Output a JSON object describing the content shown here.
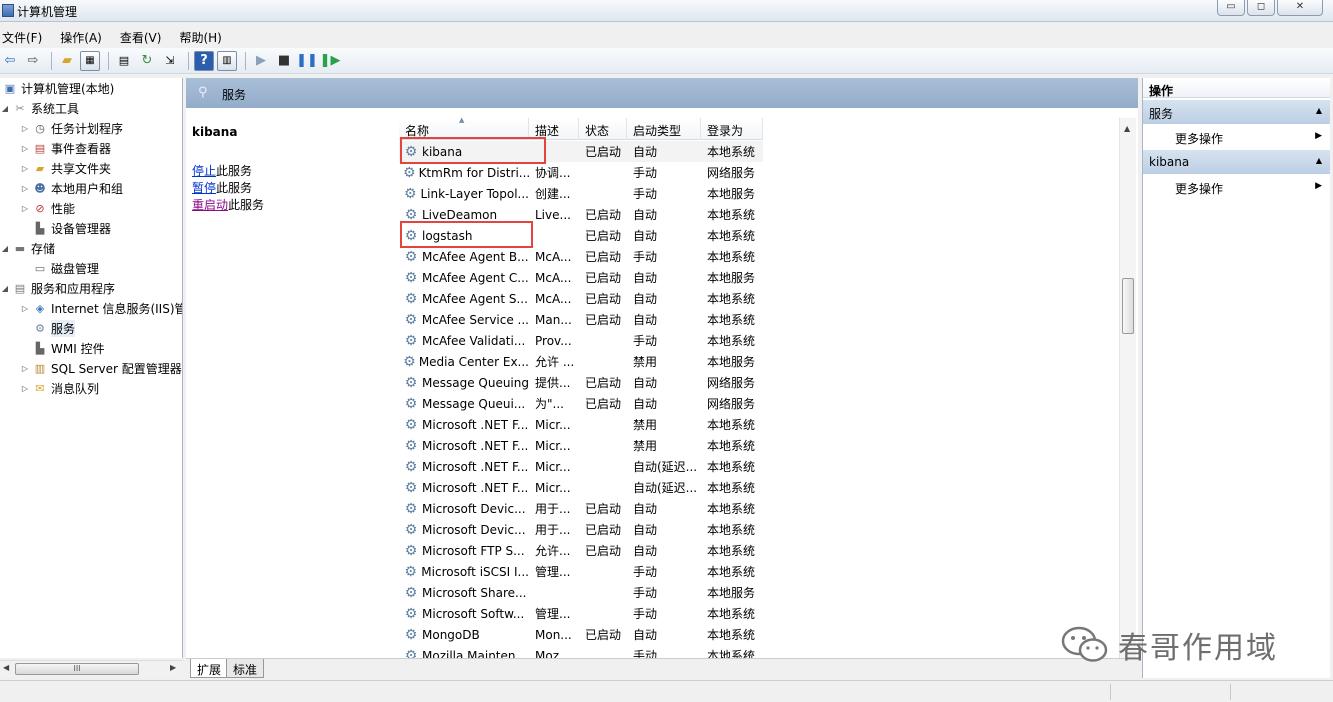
{
  "window": {
    "title": "计算机管理",
    "controls": [
      "▭",
      "◻",
      "✕"
    ]
  },
  "menu": [
    "文件(F)",
    "操作(A)",
    "查看(V)",
    "帮助(H)"
  ],
  "tree": {
    "root": "计算机管理(本地)",
    "items": [
      {
        "label": "系统工具",
        "icon": "tools-icon"
      },
      {
        "label": "任务计划程序",
        "icon": "clock-icon"
      },
      {
        "label": "事件查看器",
        "icon": "event-viewer-icon"
      },
      {
        "label": "共享文件夹",
        "icon": "shared-folder-icon"
      },
      {
        "label": "本地用户和组",
        "icon": "users-icon"
      },
      {
        "label": "性能",
        "icon": "performance-icon"
      },
      {
        "label": "设备管理器",
        "icon": "device-manager-icon"
      },
      {
        "label": "存储",
        "icon": "storage-icon"
      },
      {
        "label": "磁盘管理",
        "icon": "disk-icon"
      },
      {
        "label": "服务和应用程序",
        "icon": "services-apps-icon"
      },
      {
        "label": "Internet 信息服务(IIS)管",
        "icon": "iis-icon"
      },
      {
        "label": "服务",
        "icon": "gear-icon"
      },
      {
        "label": "WMI 控件",
        "icon": "wmi-icon"
      },
      {
        "label": "SQL Server 配置管理器",
        "icon": "sql-icon"
      },
      {
        "label": "消息队列",
        "icon": "queue-icon"
      }
    ],
    "scroll_thumb": "III"
  },
  "services_header": "服务",
  "detail": {
    "service_name": "kibana",
    "actions": [
      {
        "link": "停止",
        "rest": "此服务"
      },
      {
        "link": "暂停",
        "rest": "此服务"
      },
      {
        "link": "重启动",
        "rest": "此服务"
      }
    ]
  },
  "columns": [
    "名称",
    "描述",
    "状态",
    "启动类型",
    "登录为"
  ],
  "services": [
    {
      "name": "kibana",
      "desc": "",
      "status": "已启动",
      "startup": "自动",
      "logon": "本地系统"
    },
    {
      "name": "KtmRm for Distri...",
      "desc": "协调...",
      "status": "",
      "startup": "手动",
      "logon": "网络服务"
    },
    {
      "name": "Link-Layer Topol...",
      "desc": "创建...",
      "status": "",
      "startup": "手动",
      "logon": "本地服务"
    },
    {
      "name": "LiveDeamon",
      "desc": "Live...",
      "status": "已启动",
      "startup": "自动",
      "logon": "本地系统"
    },
    {
      "name": "logstash",
      "desc": "",
      "status": "已启动",
      "startup": "自动",
      "logon": "本地系统"
    },
    {
      "name": "McAfee Agent B...",
      "desc": "McA...",
      "status": "已启动",
      "startup": "手动",
      "logon": "本地系统"
    },
    {
      "name": "McAfee Agent C...",
      "desc": "McA...",
      "status": "已启动",
      "startup": "自动",
      "logon": "本地服务"
    },
    {
      "name": "McAfee Agent S...",
      "desc": "McA...",
      "status": "已启动",
      "startup": "自动",
      "logon": "本地系统"
    },
    {
      "name": "McAfee Service ...",
      "desc": "Man...",
      "status": "已启动",
      "startup": "自动",
      "logon": "本地系统"
    },
    {
      "name": "McAfee Validati...",
      "desc": "Prov...",
      "status": "",
      "startup": "手动",
      "logon": "本地系统"
    },
    {
      "name": "Media Center Ex...",
      "desc": "允许 ...",
      "status": "",
      "startup": "禁用",
      "logon": "本地服务"
    },
    {
      "name": "Message Queuing",
      "desc": "提供...",
      "status": "已启动",
      "startup": "自动",
      "logon": "网络服务"
    },
    {
      "name": "Message Queui...",
      "desc": "为\"...",
      "status": "已启动",
      "startup": "自动",
      "logon": "网络服务"
    },
    {
      "name": "Microsoft .NET F...",
      "desc": "Micr...",
      "status": "",
      "startup": "禁用",
      "logon": "本地系统"
    },
    {
      "name": "Microsoft .NET F...",
      "desc": "Micr...",
      "status": "",
      "startup": "禁用",
      "logon": "本地系统"
    },
    {
      "name": "Microsoft .NET F...",
      "desc": "Micr...",
      "status": "",
      "startup": "自动(延迟...",
      "logon": "本地系统"
    },
    {
      "name": "Microsoft .NET F...",
      "desc": "Micr...",
      "status": "",
      "startup": "自动(延迟...",
      "logon": "本地系统"
    },
    {
      "name": "Microsoft Devic...",
      "desc": "用于...",
      "status": "已启动",
      "startup": "自动",
      "logon": "本地系统"
    },
    {
      "name": "Microsoft Devic...",
      "desc": "用于...",
      "status": "已启动",
      "startup": "自动",
      "logon": "本地系统"
    },
    {
      "name": "Microsoft FTP S...",
      "desc": "允许...",
      "status": "已启动",
      "startup": "自动",
      "logon": "本地系统"
    },
    {
      "name": "Microsoft iSCSI I...",
      "desc": "管理...",
      "status": "",
      "startup": "手动",
      "logon": "本地系统"
    },
    {
      "name": "Microsoft Share...",
      "desc": "",
      "status": "",
      "startup": "手动",
      "logon": "本地服务"
    },
    {
      "name": "Microsoft Softw...",
      "desc": "管理...",
      "status": "",
      "startup": "手动",
      "logon": "本地系统"
    },
    {
      "name": "MongoDB",
      "desc": "Mon...",
      "status": "已启动",
      "startup": "自动",
      "logon": "本地系统"
    },
    {
      "name": "Mozilla Mainten...",
      "desc": "Moz...",
      "status": "",
      "startup": "手动",
      "logon": "本地系统"
    }
  ],
  "highlighted_services": [
    "kibana",
    "logstash"
  ],
  "highlight_color": "#e2453c",
  "bottom_tabs": [
    "扩展",
    "标准"
  ],
  "actions_pane": {
    "title": "操作",
    "sections": [
      {
        "label": "服务",
        "item": "更多操作"
      },
      {
        "label": "kibana",
        "item": "更多操作"
      }
    ]
  },
  "watermark": "春哥作用域"
}
